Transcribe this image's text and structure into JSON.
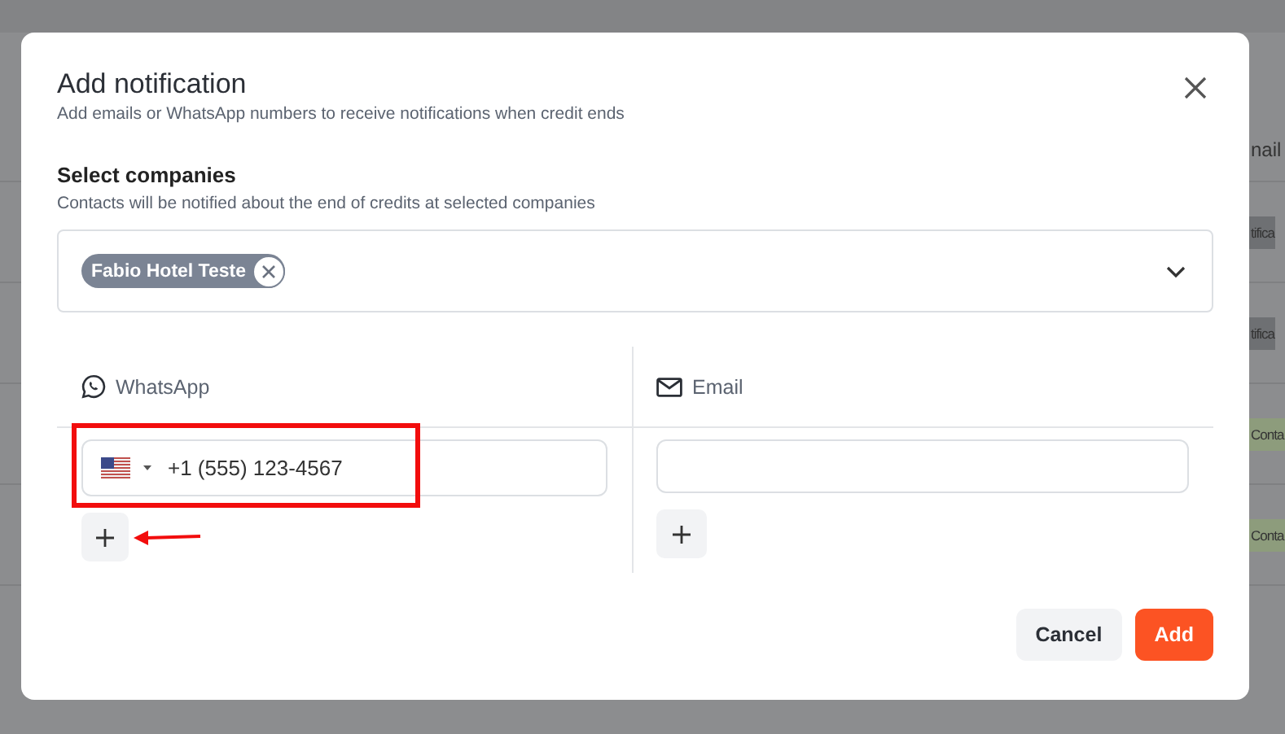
{
  "background": {
    "column_header": "nail",
    "rows": [
      {
        "badge": "tifica",
        "color": "#6e7073"
      },
      {
        "badge": "tifica",
        "color": "#6e7073"
      },
      {
        "badge": "Conta",
        "color": "#8d9c7c"
      },
      {
        "badge": "Conta",
        "color": "#8d9c7c"
      }
    ]
  },
  "dialog": {
    "title": "Add notification",
    "subtitle": "Add emails or WhatsApp numbers to receive notifications when credit ends",
    "companies": {
      "label": "Select companies",
      "description": "Contacts will be notified about the end of credits at selected companies",
      "selected": [
        "Fabio Hotel Teste"
      ]
    },
    "whatsapp": {
      "header": "WhatsApp",
      "phones": [
        {
          "value": "+1 (555) 123-4567",
          "highlighted": true
        }
      ]
    },
    "email": {
      "header": "Email"
    },
    "buttons": [
      {
        "label": "Cancel",
        "kind": "secondary"
      },
      {
        "label": "Add",
        "kind": "primary"
      }
    ]
  }
}
